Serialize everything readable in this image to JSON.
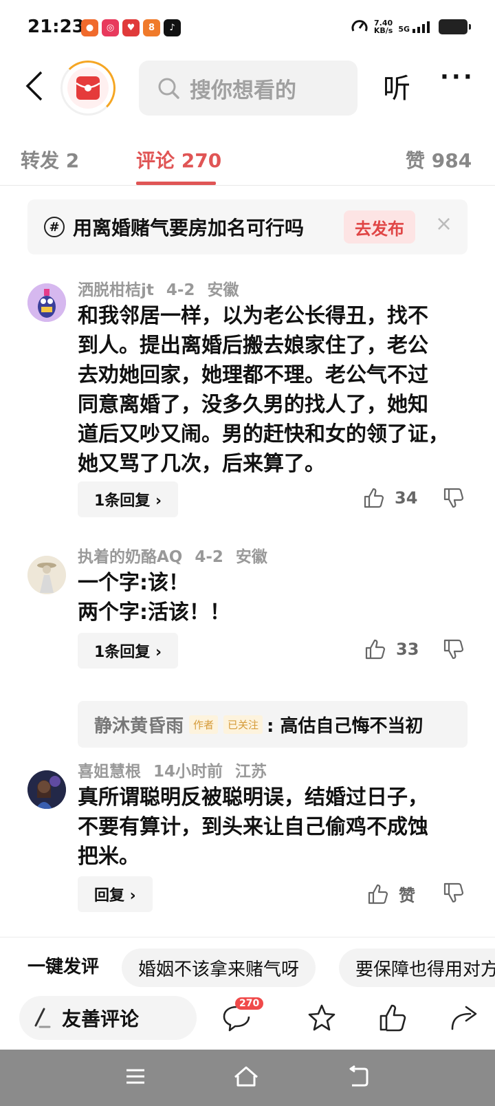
{
  "status": {
    "time": "21:23",
    "speed_top": "7.40",
    "speed_unit": "KB/s",
    "network": "5G"
  },
  "header": {
    "search_placeholder": "搜你想看的",
    "listen_label": "听",
    "more_label": "···"
  },
  "tabs": [
    {
      "label": "转发 2",
      "active": false
    },
    {
      "label": "评论 270",
      "active": true
    },
    {
      "label": "赞 984",
      "active": false
    }
  ],
  "topic": {
    "text": "用离婚赌气要房加名可行吗",
    "action": "去发布",
    "close": "×"
  },
  "comments": [
    {
      "author": "洒脱柑桔jt",
      "date": "4-2",
      "location": "安徽",
      "lines": [
        "和我邻居一样，以为老公长得丑，找不",
        "到人。提出离婚后搬去娘家住了，老公",
        "去劝她回家，她理都不理。老公气不过",
        "同意离婚了，没多久男的找人了，她知",
        "道后又吵又闹。男的赶快和女的领了证，",
        "她又骂了几次，后来算了。"
      ],
      "reply_label": "1条回复 ›",
      "likes": "34"
    },
    {
      "author": "执着的奶酪AQ",
      "date": "4-2",
      "location": "安徽",
      "lines": [
        "一个字:该！",
        "两个字:活该！！"
      ],
      "reply_label": "1条回复 ›",
      "likes": "33",
      "sub_reply": {
        "name": "静沐黄昏雨",
        "tag_author": "作者",
        "tag_followed": "已关注",
        "text": ": 高估自己悔不当初"
      }
    },
    {
      "author": "喜姐慧根",
      "date": "14小时前",
      "location": "江苏",
      "lines": [
        "真所谓聪明反被聪明误，结婚过日子，",
        "不要有算计，到头来让自己偷鸡不成蚀",
        "把米。"
      ],
      "reply_label": "回复 ›",
      "likes": "赞"
    }
  ],
  "quick": {
    "label": "一键发评",
    "chips": [
      "婚姻不该拿来赌气呀",
      "要保障也得用对方"
    ]
  },
  "action_bar": {
    "input_label": "友善评论",
    "comment_count": "270"
  },
  "colors": {
    "accent": "#e05555",
    "badge": "#f04a4a",
    "nav_bar": "#8b8b8b"
  }
}
